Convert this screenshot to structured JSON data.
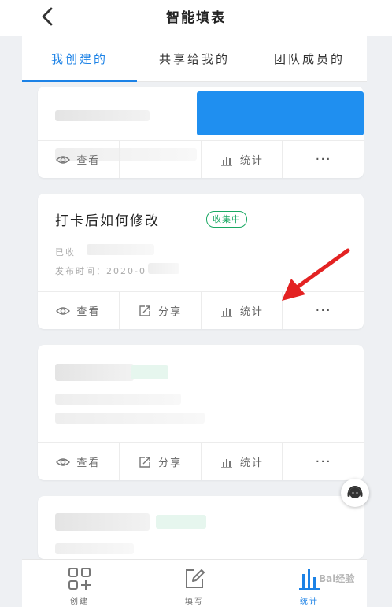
{
  "header": {
    "title": "智能填表"
  },
  "tabs": [
    {
      "label": "我创建的",
      "active": true
    },
    {
      "label": "共享给我的",
      "active": false
    },
    {
      "label": "团队成员的",
      "active": false
    }
  ],
  "card1": {
    "actions": {
      "view": "查看",
      "stats": "统计",
      "more": "···"
    }
  },
  "card2": {
    "title": "打卡后如何修改",
    "status": "收集中",
    "meta_collected": "已收",
    "meta_published": "发布时间：2020-0",
    "actions": {
      "view": "查看",
      "share": "分享",
      "stats": "统计",
      "more": "···"
    }
  },
  "card3": {
    "actions": {
      "view": "查看",
      "share": "分享",
      "stats": "统计",
      "more": "···"
    }
  },
  "bottom_nav": [
    {
      "label": "创建",
      "icon": "grid-plus-icon",
      "active": false
    },
    {
      "label": "填写",
      "icon": "edit-icon",
      "active": false
    },
    {
      "label": "统计",
      "icon": "bar-chart-icon",
      "active": true
    }
  ],
  "watermark": "Bai经验",
  "colors": {
    "accent": "#1c82e6",
    "status_green": "#19a863",
    "annotation_red": "#e32222"
  }
}
